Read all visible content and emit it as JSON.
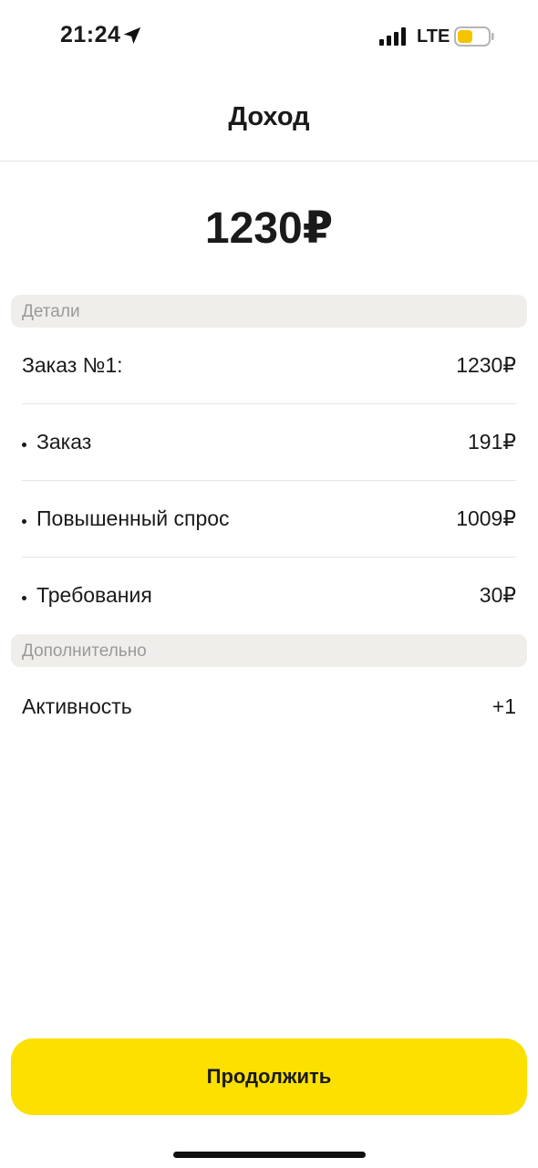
{
  "status_bar": {
    "time": "21:24",
    "network": "LTE",
    "icons": [
      "location-arrow-icon",
      "signal-icon",
      "battery-icon"
    ],
    "battery_color": "#f5c400"
  },
  "header": {
    "title": "Доход"
  },
  "total": "1230₽",
  "sections": {
    "details_title": "Детали",
    "additional_title": "Дополнительно"
  },
  "details": [
    {
      "label": "Заказ №1:",
      "value": "1230₽"
    },
    {
      "label": "Заказ",
      "value": "191₽"
    },
    {
      "label": "Повышенный спрос",
      "value": "1009₽"
    },
    {
      "label": "Требования",
      "value": "30₽"
    }
  ],
  "additional": [
    {
      "label": "Активность",
      "value": "+1"
    }
  ],
  "actions": {
    "continue_label": "Продолжить"
  },
  "colors": {
    "accent": "#fce000",
    "section_bg": "#f0eeeb",
    "section_text": "#9a9a9a"
  }
}
